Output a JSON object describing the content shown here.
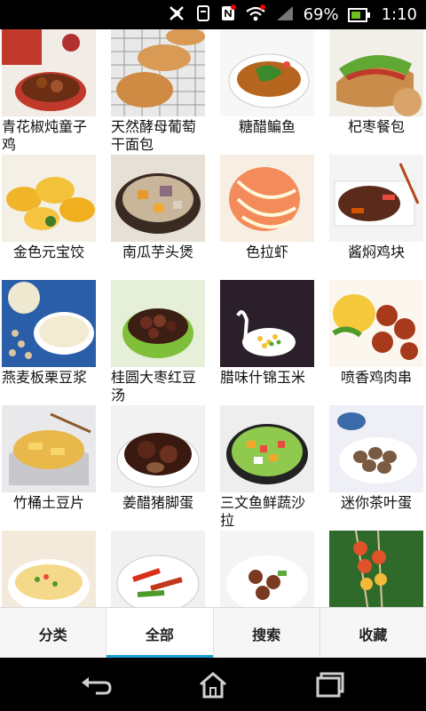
{
  "status_bar": {
    "battery_percent": "69%",
    "time": "1:10",
    "icons": [
      "bluetooth-off-icon",
      "vibrate-icon",
      "nfc-icon",
      "wifi-icon",
      "signal-icon",
      "battery-icon"
    ]
  },
  "recipes": [
    {
      "title": "青花椒炖童子鸡"
    },
    {
      "title": "天然酵母葡萄干面包"
    },
    {
      "title": "糖醋鳊鱼"
    },
    {
      "title": "杞枣餐包"
    },
    {
      "title": "金色元宝饺"
    },
    {
      "title": "南瓜芋头煲"
    },
    {
      "title": "色拉虾"
    },
    {
      "title": "酱焖鸡块"
    },
    {
      "title": "燕麦板栗豆浆"
    },
    {
      "title": "桂圆大枣红豆汤"
    },
    {
      "title": "腊味什锦玉米"
    },
    {
      "title": "喷香鸡肉串"
    },
    {
      "title": "竹桶土豆片"
    },
    {
      "title": "姜醋猪脚蛋"
    },
    {
      "title": "三文鱼鲜蔬沙拉"
    },
    {
      "title": "迷你茶叶蛋"
    },
    {
      "title": ""
    },
    {
      "title": ""
    },
    {
      "title": ""
    },
    {
      "title": ""
    }
  ],
  "tabs": [
    {
      "label": "分类"
    },
    {
      "label": "全部"
    },
    {
      "label": "搜索"
    },
    {
      "label": "收藏"
    }
  ],
  "active_tab": "全部",
  "colors": {
    "accent": "#1aa0d8",
    "status_bg": "#000000",
    "battery_fill": "#6fbf1f"
  },
  "nav_icons": [
    "back-icon",
    "home-icon",
    "recent-apps-icon"
  ]
}
